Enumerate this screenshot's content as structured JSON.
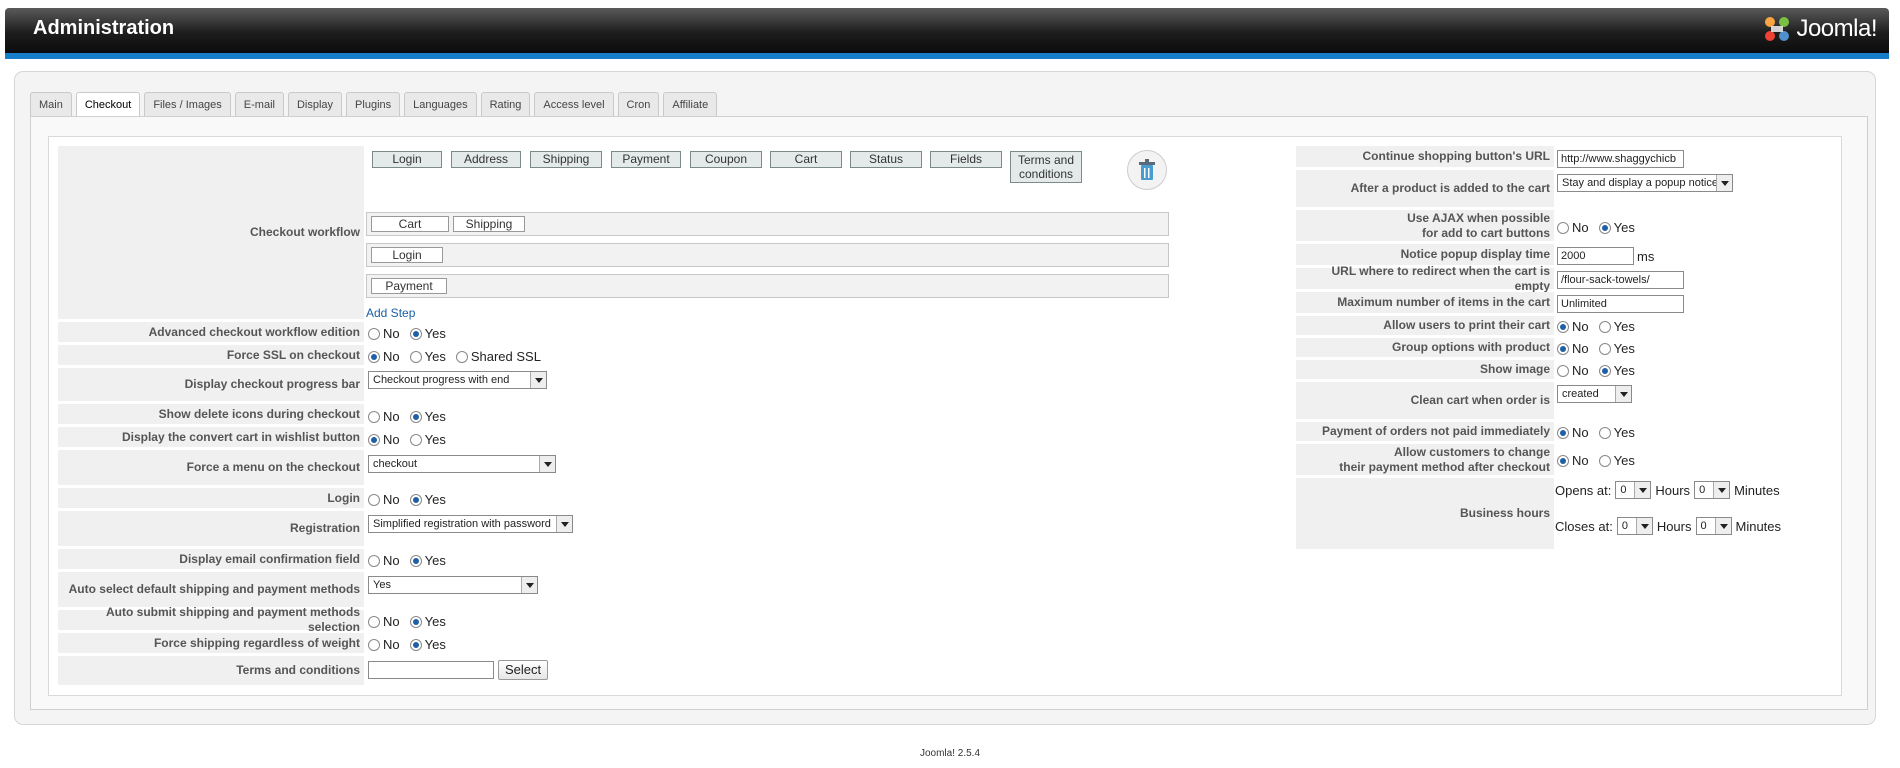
{
  "header": {
    "title": "Administration",
    "logo_text": "Joomla!"
  },
  "tabs": [
    "Main",
    "Checkout",
    "Files / Images",
    "E-mail",
    "Display",
    "Plugins",
    "Languages",
    "Rating",
    "Access level",
    "Cron",
    "Affiliate"
  ],
  "workflow": {
    "label": "Checkout workflow",
    "available_steps": [
      "Login",
      "Address",
      "Shipping",
      "Payment",
      "Coupon",
      "Cart",
      "Status",
      "Fields",
      "Terms and conditions"
    ],
    "rows": [
      [
        "Cart",
        "Shipping"
      ],
      [
        "Login"
      ],
      [
        "Payment"
      ]
    ],
    "add_step": "Add Step",
    "trash_icon": "trash-icon"
  },
  "left": {
    "advanced": {
      "label": "Advanced checkout workflow edition",
      "no": "No",
      "yes": "Yes"
    },
    "force_ssl": {
      "label": "Force SSL on checkout",
      "no": "No",
      "yes": "Yes",
      "shared": "Shared SSL"
    },
    "progress": {
      "label": "Display checkout progress bar",
      "value": "Checkout progress with end"
    },
    "delete_icons": {
      "label": "Show delete icons during checkout",
      "no": "No",
      "yes": "Yes"
    },
    "wishlist": {
      "label": "Display the convert cart in wishlist button",
      "no": "No",
      "yes": "Yes"
    },
    "menu": {
      "label": "Force a menu on the checkout",
      "value": "checkout"
    },
    "login": {
      "label": "Login",
      "no": "No",
      "yes": "Yes"
    },
    "registration": {
      "label": "Registration",
      "value": "Simplified registration with password"
    },
    "email_confirm": {
      "label": "Display email confirmation field",
      "no": "No",
      "yes": "Yes"
    },
    "auto_select": {
      "label": "Auto select default shipping and payment methods",
      "value": "Yes"
    },
    "auto_submit": {
      "label": "Auto submit shipping and payment methods selection",
      "no": "No",
      "yes": "Yes"
    },
    "force_ship": {
      "label": "Force shipping regardless of weight",
      "no": "No",
      "yes": "Yes"
    },
    "terms": {
      "label": "Terms and conditions",
      "value": "",
      "button": "Select"
    }
  },
  "right": {
    "continue_url": {
      "label": "Continue shopping button's URL",
      "value": "http://www.shaggychicb"
    },
    "after_add": {
      "label": "After a product is added to the cart",
      "value": "Stay and display a popup notice"
    },
    "ajax": {
      "label_1": "Use AJAX when possible",
      "label_2": "for add to cart buttons",
      "no": "No",
      "yes": "Yes"
    },
    "popup_time": {
      "label": "Notice popup display time",
      "value": "2000",
      "unit": "ms"
    },
    "empty_redirect": {
      "label": "URL where to redirect when the cart is empty",
      "value": "/flour-sack-towels/"
    },
    "max_items": {
      "label": "Maximum number of items in the cart",
      "value": "Unlimited"
    },
    "print_cart": {
      "label": "Allow users to print their cart",
      "no": "No",
      "yes": "Yes"
    },
    "group_options": {
      "label": "Group options with product",
      "no": "No",
      "yes": "Yes"
    },
    "show_image": {
      "label": "Show image",
      "no": "No",
      "yes": "Yes"
    },
    "clean_cart": {
      "label": "Clean cart when order is",
      "value": "created"
    },
    "unpaid": {
      "label": "Payment of orders not paid immediately",
      "no": "No",
      "yes": "Yes"
    },
    "change_payment": {
      "label_1": "Allow customers to change",
      "label_2": "their payment method after checkout",
      "no": "No",
      "yes": "Yes"
    },
    "business_hours": {
      "label": "Business hours",
      "opens": "Opens at:",
      "closes": "Closes at:",
      "hours": "Hours",
      "minutes": "Minutes",
      "open_h": "0",
      "open_m": "0",
      "close_h": "0",
      "close_m": "0"
    }
  },
  "footer": "Joomla! 2.5.4",
  "colors": {
    "header_bar": "#167dc8",
    "radio_selected": "#1f5fa8",
    "link": "#1a5fa5"
  }
}
